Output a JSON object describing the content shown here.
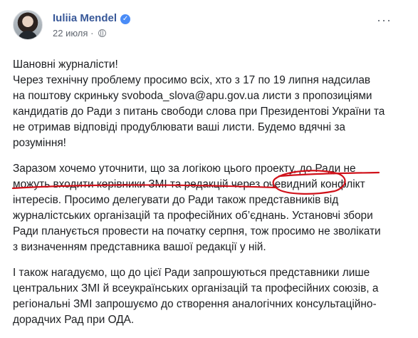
{
  "post": {
    "author_name": "Iuliia Mendel",
    "date": "22 июля",
    "more_menu_label": "···",
    "greeting": "Шановні журналісти!",
    "paragraph1_lines": [
      "Через технічну проблему просимо всіх, хто з 17 по 19 липня надсилав",
      "на поштову скриньку svoboda_slova@apu.gov.ua листи з пропозиціями",
      "кандидатів до Ради з питань свободи слова при Президентові України та",
      "не отримав відповіді продублювати ваші листи. Будемо вдячні за",
      "розуміння!"
    ],
    "paragraph2_lines": [
      "Заразом хочемо уточнити, що за логікою цього проекту, до Ради не",
      "можуть входити керівники ЗМІ та редакцій через очевидний конфлікт",
      "інтересів. Просимо делегувати до Ради також представників від",
      "журналістських організацій та професійних об’єднань. Установчі збори",
      "Ради планується провести на початку серпня, тож просимо не зволікати",
      "з визначенням представника вашої редакції у ній."
    ],
    "paragraph3_lines": [
      "І також нагадуємо, що до цієї Ради запрошуються представники лише",
      "центральних ЗМІ й всеукраїнських організацій та професійних союзів, а",
      "регіональні ЗМІ запрошуємо до створення аналогічних консультаційно-",
      "дорадчих Рад при ОДА."
    ]
  },
  "colors": {
    "author_link": "#385898",
    "verified_badge": "#4a8cf7",
    "annotation_ink": "#d0121b"
  },
  "icons": {
    "verified": "verified-badge-icon",
    "audience": "globe-icon",
    "menu": "more-options-icon"
  }
}
